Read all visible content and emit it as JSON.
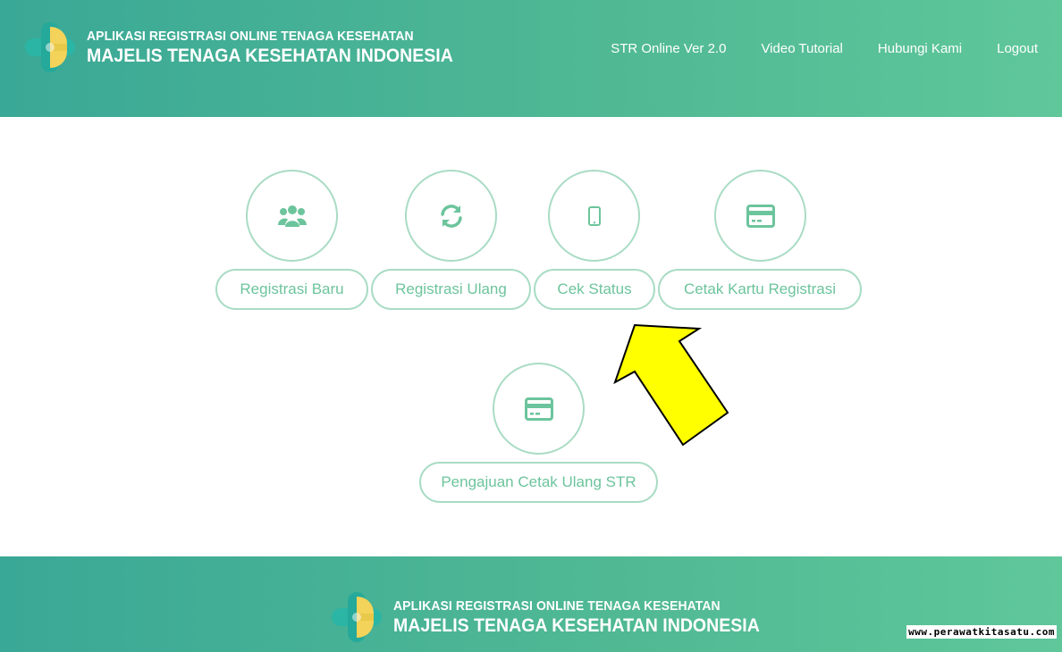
{
  "header": {
    "brand": {
      "line1": "APLIKASI REGISTRASI ONLINE TENAGA KESEHATAN",
      "line2": "MAJELIS TENAGA KESEHATAN INDONESIA"
    },
    "nav": [
      {
        "label": "STR Online Ver 2.0"
      },
      {
        "label": "Video Tutorial"
      },
      {
        "label": "Hubungi Kami"
      },
      {
        "label": "Logout"
      }
    ]
  },
  "menu": [
    {
      "label": "Registrasi Baru",
      "icon": "users-icon"
    },
    {
      "label": "Registrasi Ulang",
      "icon": "refresh-icon"
    },
    {
      "label": "Cek Status",
      "icon": "mobile-phone-icon"
    },
    {
      "label": "Cetak Kartu Registrasi",
      "icon": "credit-card-icon"
    },
    {
      "label": "Pengajuan Cetak Ulang STR",
      "icon": "credit-card-icon"
    }
  ],
  "annotation": {
    "icon": "yellow-arrow-pointer"
  },
  "footer": {
    "brand": {
      "line1": "APLIKASI REGISTRASI ONLINE TENAGA KESEHATAN",
      "line2": "MAJELIS TENAGA KESEHATAN INDONESIA"
    }
  },
  "watermark": "www.perawatkitasatu.com",
  "colors": {
    "header_gradient_start": "#3aa896",
    "header_gradient_end": "#5fc79a",
    "accent_green": "#6cc49c",
    "border_green": "#a9dcc4",
    "arrow_fill": "#ffff00"
  }
}
